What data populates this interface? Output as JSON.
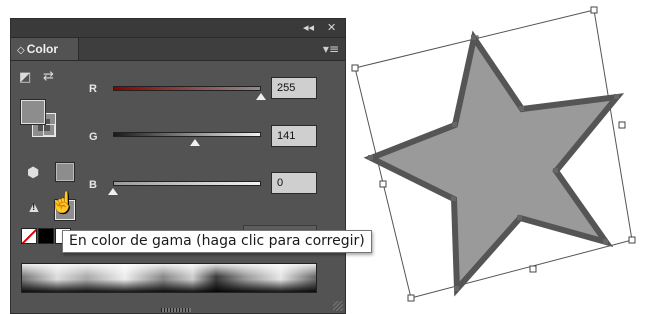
{
  "panel": {
    "tab_title": "Color",
    "tab_arrows": "◇",
    "collapse_icon": "◂◂",
    "close_icon": "✕",
    "menu_icon": "▾≡"
  },
  "channels": [
    {
      "label": "R",
      "value": "255",
      "level": 1.0
    },
    {
      "label": "G",
      "value": "141",
      "level": 0.553
    },
    {
      "label": "B",
      "value": "0",
      "level": 0.0
    }
  ],
  "icons": {
    "swap": "⇄",
    "default_colors": "◩",
    "web_safe": "⬢",
    "warning": "▲",
    "warning_mark": "!",
    "hand": "☝"
  },
  "tooltip": {
    "text": "En color de gama (haga clic para corregir)"
  },
  "colors": {
    "fill": "#8d8d8d",
    "star_fill": "#9a9a9a",
    "star_stroke": "#555555"
  }
}
